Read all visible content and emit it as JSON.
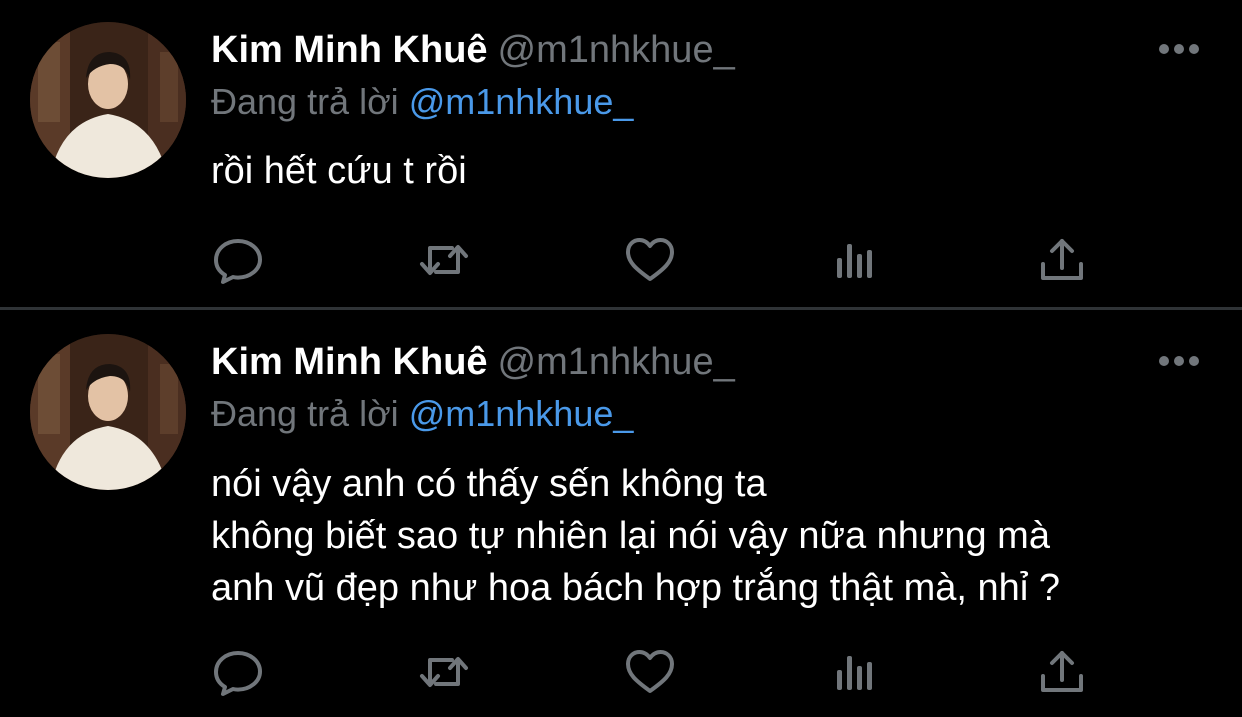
{
  "tweets": [
    {
      "author": {
        "display_name": "Kim Minh Khuê",
        "handle": "@m1nhkhue_",
        "avatar": "profile-photo"
      },
      "reply_to": {
        "prefix": "Đang trả lời",
        "mention": "@m1nhkhue_"
      },
      "lines": [
        "rồi hết cứu t rồi"
      ],
      "actions": [
        "reply-icon",
        "retweet-icon",
        "like-icon",
        "views-icon",
        "share-icon"
      ]
    },
    {
      "author": {
        "display_name": "Kim Minh Khuê",
        "handle": "@m1nhkhue_",
        "avatar": "profile-photo"
      },
      "reply_to": {
        "prefix": "Đang trả lời",
        "mention": "@m1nhkhue_"
      },
      "lines": [
        "nói vậy anh có thấy sến không ta",
        "không biết sao tự nhiên lại nói vậy nữa nhưng mà",
        "anh vũ đẹp như hoa bách hợp trắng thật mà, nhỉ ?"
      ],
      "actions": [
        "reply-icon",
        "retweet-icon",
        "like-icon",
        "views-icon",
        "share-icon"
      ]
    }
  ],
  "colors": {
    "background": "#000000",
    "text": "#ffffff",
    "muted": "#71767b",
    "mention": "#4a99e9",
    "divider": "#2f3336"
  }
}
